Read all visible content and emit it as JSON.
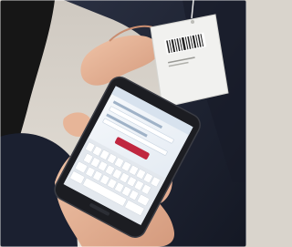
{
  "scene": {
    "description_kind": "photo",
    "colors": {
      "background": "#d9d4cc",
      "suit": "#1e2433",
      "tag": "#f1f1ef",
      "phone_body": "#1c1d22",
      "screen": "#eef3f8",
      "screen_accent": "#c0263f",
      "skin": "#e8b79c"
    }
  },
  "elements": {
    "garment_tag": {
      "icon": "barcode-icon"
    },
    "phone": {
      "icon": "smartphone-icon"
    },
    "screen": {
      "button_icon": "button-icon",
      "keyboard_icon": "keyboard-icon"
    }
  }
}
